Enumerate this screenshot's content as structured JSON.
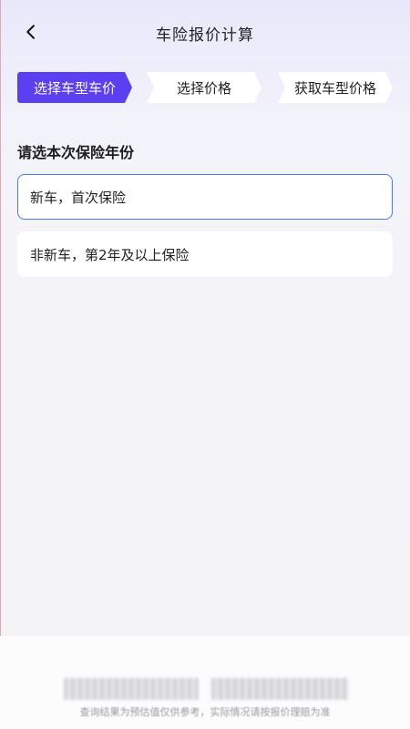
{
  "header": {
    "title": "车险报价计算",
    "back_icon": "chevron-left-icon"
  },
  "steps": [
    {
      "label": "选择车型车价",
      "active": true
    },
    {
      "label": "选择价格",
      "active": false
    },
    {
      "label": "获取车型价格",
      "active": false
    }
  ],
  "section": {
    "title": "请选本次保险年份"
  },
  "options": [
    {
      "label": "新车，首次保险",
      "selected": true
    },
    {
      "label": "非新车，第2年及以上保险",
      "selected": false
    }
  ],
  "footer": {
    "disclaimer": "查询结果为预估值仅供参考，实际情况请按报价理赔为准"
  },
  "colors": {
    "accent": "#5b40f2",
    "selected_border": "#4a79e8",
    "background": "#f4f4f7"
  }
}
